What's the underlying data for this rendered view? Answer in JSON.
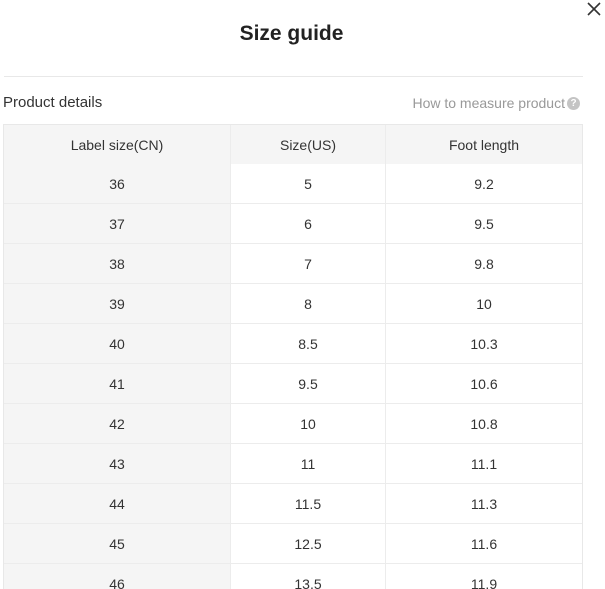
{
  "dialog": {
    "title": "Size guide",
    "close_icon": "close-icon"
  },
  "section": {
    "label": "Product details",
    "how_to_measure": "How to measure product",
    "help_icon": "question-circle-icon"
  },
  "table": {
    "headers": [
      "Label size(CN)",
      "Size(US)",
      "Foot length"
    ],
    "rows": [
      [
        "36",
        "5",
        "9.2"
      ],
      [
        "37",
        "6",
        "9.5"
      ],
      [
        "38",
        "7",
        "9.8"
      ],
      [
        "39",
        "8",
        "10"
      ],
      [
        "40",
        "8.5",
        "10.3"
      ],
      [
        "41",
        "9.5",
        "10.6"
      ],
      [
        "42",
        "10",
        "10.8"
      ],
      [
        "43",
        "11",
        "11.1"
      ],
      [
        "44",
        "11.5",
        "11.3"
      ],
      [
        "45",
        "12.5",
        "11.6"
      ],
      [
        "46",
        "13.5",
        "11.9"
      ]
    ]
  }
}
